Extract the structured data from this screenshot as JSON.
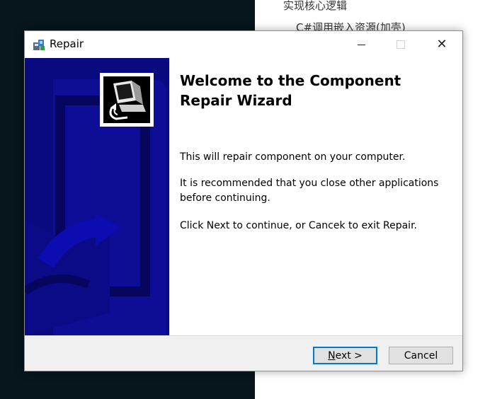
{
  "background": {
    "line1": "实现核心逻辑",
    "line2": "C#调用嵌入资源(加壳)"
  },
  "window": {
    "title": "Repair",
    "controls": {
      "minimize_icon": "minimize-icon",
      "maximize_icon": "maximize-icon",
      "close_icon": "close-icon",
      "close_glyph": "✕"
    }
  },
  "wizard": {
    "heading": "Welcome to the Component Repair Wizard",
    "paragraph1": "This will repair component on your computer.",
    "paragraph2": "It is recommended that you close other applications before continuing.",
    "paragraph3": "Click Next to continue, or Cancek to exit Repair."
  },
  "buttons": {
    "next_prefix": "N",
    "next_rest": "ext >",
    "cancel": "Cancel"
  },
  "colors": {
    "side_panel": "#0a0a80",
    "accent": "#0078d7",
    "dark_bg": "#06161c"
  }
}
